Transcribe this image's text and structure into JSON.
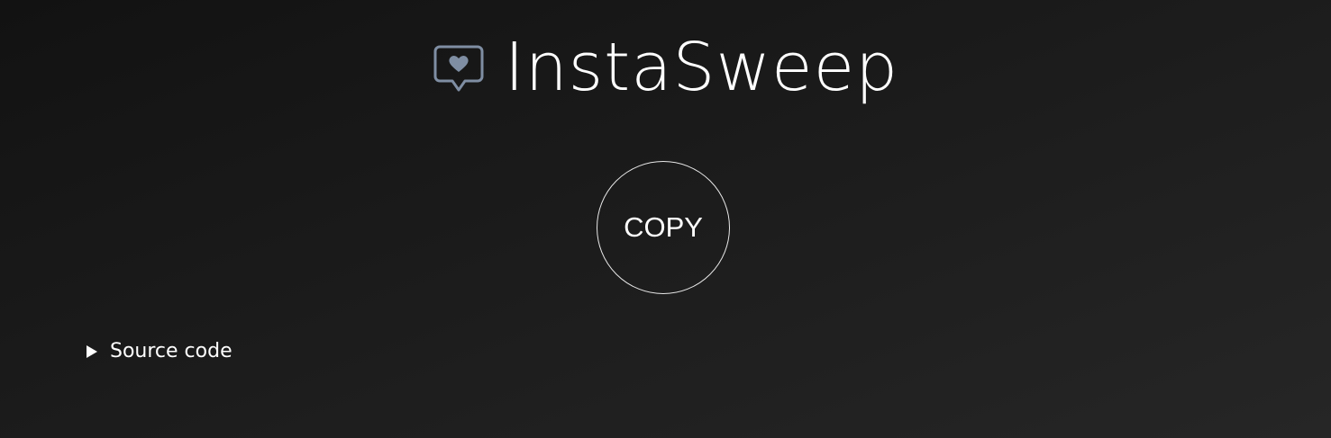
{
  "header": {
    "title": "InstaSweep",
    "icon": "heart-speech-bubble-icon",
    "icon_color": "#7f8ea3"
  },
  "main": {
    "copy_label": "COPY"
  },
  "source": {
    "label": "Source code",
    "icon": "disclosure-triangle-icon"
  },
  "colors": {
    "background": "#1b1b1b",
    "text": "#ffffff"
  }
}
